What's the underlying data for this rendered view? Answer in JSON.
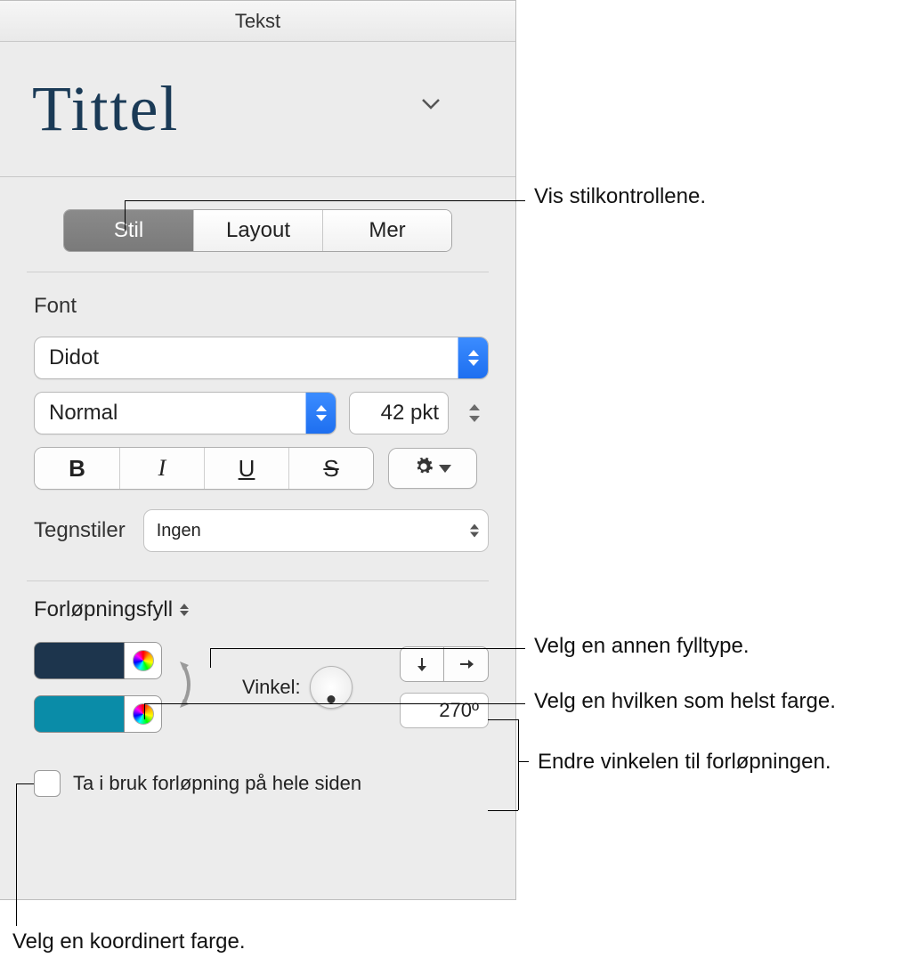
{
  "panel": {
    "header": "Tekst",
    "title": "Tittel",
    "tabs": {
      "stil": "Stil",
      "layout": "Layout",
      "mer": "Mer"
    },
    "font": {
      "label": "Font",
      "family": "Didot",
      "weight": "Normal",
      "size": "42 pkt",
      "char_styles_label": "Tegnstiler",
      "char_styles_value": "Ingen"
    },
    "fill": {
      "type_label": "Forløpningsfyll",
      "angle_label": "Vinkel:",
      "angle_value": "270º",
      "colors": {
        "start": "#1d354d",
        "end": "#0a8ca8"
      },
      "apply_whole_page": "Ta i bruk forløpning på hele siden"
    }
  },
  "callouts": {
    "show_style_controls": "Vis stilkontrollene.",
    "choose_fill_type": "Velg en annen fylltype.",
    "choose_any_color": "Velg en hvilken som helst farge.",
    "change_angle": "Endre vinkelen til forløpningen.",
    "choose_coordinated_color": "Velg en koordinert farge."
  }
}
